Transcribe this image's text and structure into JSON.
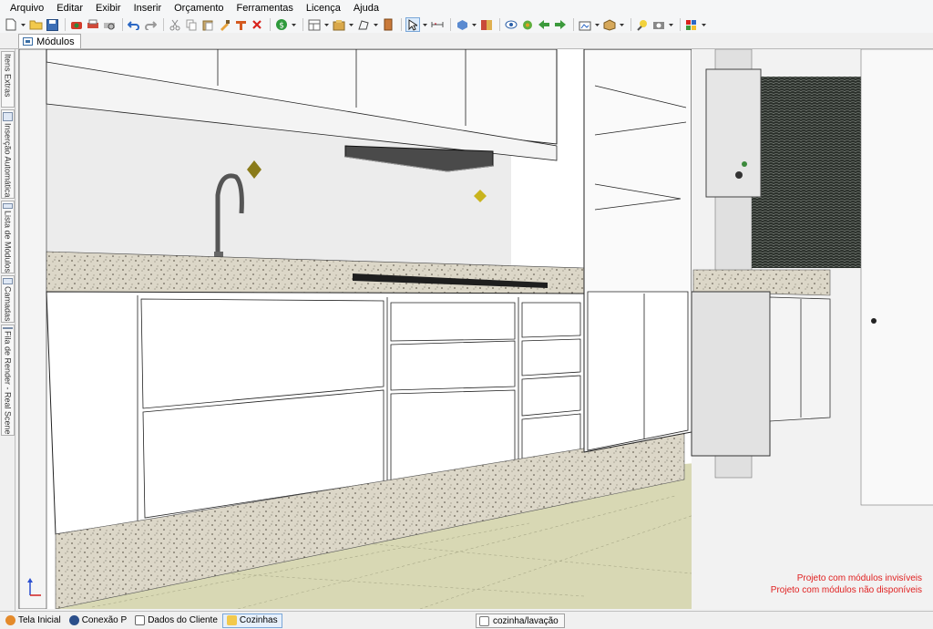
{
  "menu": [
    "Arquivo",
    "Editar",
    "Exibir",
    "Inserir",
    "Orçamento",
    "Ferramentas",
    "Licença",
    "Ajuda"
  ],
  "tabs": {
    "modulos": "Módulos"
  },
  "sidebar": [
    {
      "label": "Itens Extras",
      "icon": "extras-icon"
    },
    {
      "label": "Inserção Automática",
      "icon": "auto-insert-icon"
    },
    {
      "label": "Lista de Módulos",
      "icon": "module-list-icon"
    },
    {
      "label": "Camadas",
      "icon": "layers-icon"
    },
    {
      "label": "Fila de Render - Real Scene",
      "icon": "render-queue-icon"
    }
  ],
  "viewport": {
    "notes": [
      "Projeto com módulos invisíveis",
      "Projeto com módulos não disponíveis"
    ],
    "note_color": "#e02020"
  },
  "statusbar": {
    "tabs": [
      {
        "label": "Tela Inicial",
        "icon": "home-icon"
      },
      {
        "label": "Conexão P",
        "icon": "connection-icon"
      },
      {
        "label": "Dados do Cliente",
        "icon": "client-data-icon"
      },
      {
        "label": "Cozinhas",
        "icon": "folder-icon"
      }
    ],
    "project": "cozinha/lavação"
  }
}
